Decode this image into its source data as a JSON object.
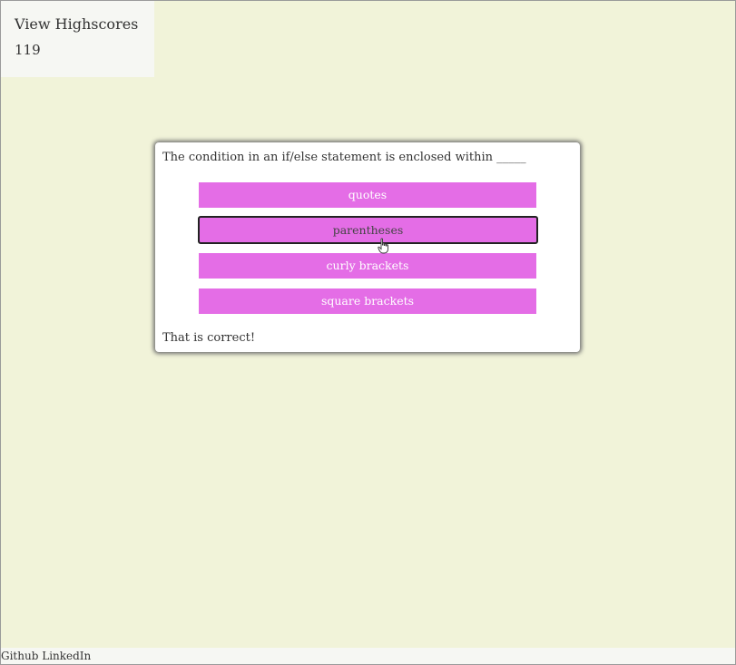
{
  "header": {
    "highscores_label": "View Highscores",
    "timer_value": "119"
  },
  "quiz": {
    "question": "The condition in an if/else statement is enclosed within _____",
    "answers": [
      {
        "label": "quotes"
      },
      {
        "label": "parentheses"
      },
      {
        "label": "curly brackets"
      },
      {
        "label": "square brackets"
      }
    ],
    "result_text": "That is correct!"
  },
  "footer": {
    "github_label": "Github",
    "linkedin_label": "LinkedIn"
  },
  "colors": {
    "background": "#f1f3d9",
    "button": "#e46de6",
    "card": "#ffffff"
  },
  "icons": {
    "cursor": "hand-pointer-icon"
  }
}
